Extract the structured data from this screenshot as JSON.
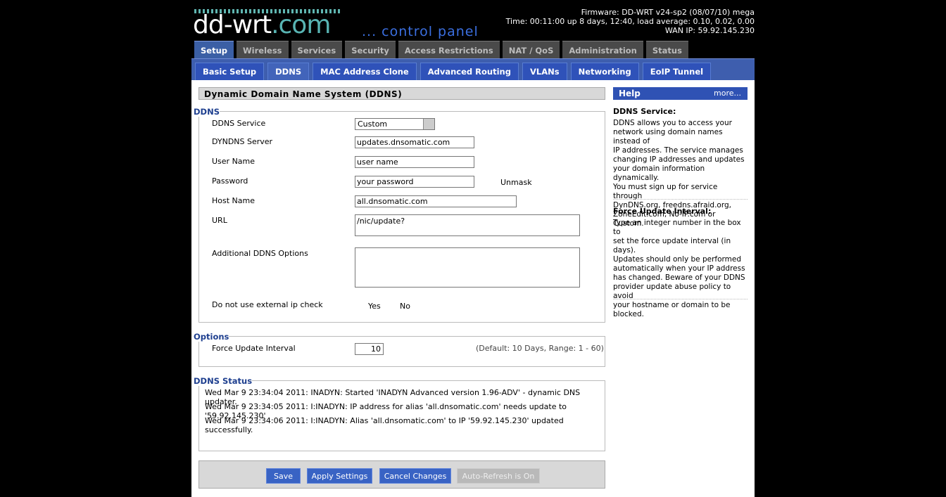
{
  "header": {
    "logo_main": "dd-wrt",
    "logo_suffix": ".com",
    "control_panel": "... control panel",
    "firmware": "Firmware: DD-WRT v24-sp2 (08/07/10) mega",
    "time": "Time: 00:11:00 up 8 days, 12:40, load average: 0.10, 0.02, 0.00",
    "wan_ip": "WAN IP: 59.92.145.230"
  },
  "main_tabs": [
    "Setup",
    "Wireless",
    "Services",
    "Security",
    "Access Restrictions",
    "NAT / QoS",
    "Administration",
    "Status"
  ],
  "sub_tabs": [
    "Basic Setup",
    "DDNS",
    "MAC Address Clone",
    "Advanced Routing",
    "VLANs",
    "Networking",
    "EoIP Tunnel"
  ],
  "section_title": "Dynamic Domain Name System (DDNS)",
  "ddns": {
    "legend": "DDNS",
    "service_label": "DDNS Service",
    "service_value": "Custom",
    "server_label": "DYNDNS Server",
    "server_value": "updates.dnsomatic.com",
    "username_label": "User Name",
    "username_value": "user name",
    "password_label": "Password",
    "password_value": "your  password",
    "unmask_label": "Unmask",
    "hostname_label": "Host Name",
    "hostname_value": "all.dnsomatic.com",
    "url_label": "URL",
    "url_value": "/nic/update?",
    "options_label": "Additional DDNS Options",
    "options_value": "",
    "extip_label": "Do not use external ip check",
    "yes_label": "Yes",
    "no_label": "No"
  },
  "options": {
    "legend": "Options",
    "force_label": "Force Update Interval",
    "force_value": "10",
    "force_hint": "(Default: 10 Days, Range: 1 - 60)"
  },
  "status": {
    "legend": "DDNS Status",
    "lines": [
      "Wed Mar 9 23:34:04 2011: INADYN: Started 'INADYN Advanced version 1.96-ADV' - dynamic DNS updater.",
      "Wed Mar 9 23:34:05 2011: I:INADYN: IP address for alias 'all.dnsomatic.com' needs update to '59.92.145.230'",
      "Wed Mar 9 23:34:06 2011: I:INADYN: Alias 'all.dnsomatic.com' to IP '59.92.145.230' updated successfully."
    ]
  },
  "buttons": {
    "save": "Save",
    "apply": "Apply Settings",
    "cancel": "Cancel Changes",
    "refresh": "Auto-Refresh is On"
  },
  "help": {
    "title": "Help",
    "more": "more...",
    "ddns_heading": "DDNS Service:",
    "ddns_lines": [
      "DDNS allows you to access your",
      "network using domain names instead of",
      "IP addresses. The service manages",
      "changing IP addresses and updates",
      "your domain information dynamically.",
      "You must sign up for service through",
      "DynDNS.org, freedns.afraid.org,",
      "ZoneEdit.com, No-IP.com or Custom."
    ],
    "force_heading": "Force Update Interval:",
    "force_lines": [
      "Type an integer number in the box to",
      "set the force update interval (in days).",
      "Updates should only be performed",
      "automatically when your IP address",
      "has changed. Beware of your DDNS",
      "provider update abuse policy to avoid",
      "your hostname or domain to be",
      "blocked."
    ]
  }
}
